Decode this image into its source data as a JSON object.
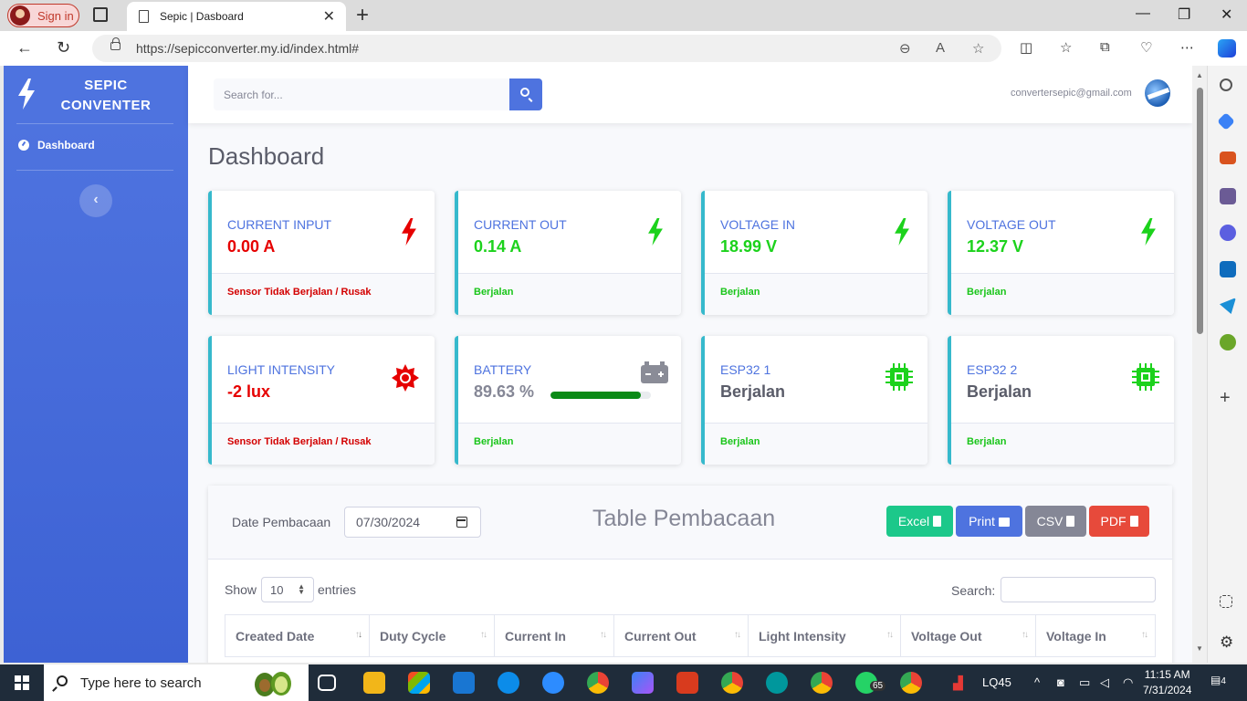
{
  "browser": {
    "signin_label": "Sign in",
    "tab_title": "Sepic | Dasboard",
    "url": "https://sepicconverter.my.id/index.html#"
  },
  "sidebar": {
    "brand_line1": "SEPIC",
    "brand_line2": "CONVENTER",
    "nav_dashboard": "Dashboard"
  },
  "topbar": {
    "search_placeholder": "Search for...",
    "user_email": "convertersepic@gmail.com"
  },
  "page": {
    "title": "Dashboard"
  },
  "cards": [
    {
      "label": "CURRENT INPUT",
      "value": "0.00 A",
      "status": "Sensor Tidak Berjalan / Rusak",
      "icon": "bolt-icon",
      "color": "#e60000"
    },
    {
      "label": "CURRENT OUT",
      "value": "0.14 A",
      "status": "Berjalan",
      "icon": "bolt-icon",
      "color": "#1cd21c"
    },
    {
      "label": "VOLTAGE IN",
      "value": "18.99 V",
      "status": "Berjalan",
      "icon": "bolt-icon",
      "color": "#1cd21c"
    },
    {
      "label": "VOLTAGE OUT",
      "value": "12.37 V",
      "status": "Berjalan",
      "icon": "bolt-icon",
      "color": "#1cd21c"
    },
    {
      "label": "LIGHT INTENSITY",
      "value": "-2 lux",
      "status": "Sensor Tidak Berjalan / Rusak",
      "icon": "sun-icon",
      "color": "#e60000"
    },
    {
      "label": "BATTERY",
      "value": "89.63 %",
      "status": "Berjalan",
      "icon": "battery-icon",
      "progress": 0.8963,
      "color": "#0a8a16"
    },
    {
      "label": "ESP32 1",
      "value": "Berjalan",
      "status": "Berjalan",
      "icon": "microchip-icon",
      "color": "#1cd21c"
    },
    {
      "label": "ESP32 2",
      "value": "Berjalan",
      "status": "Berjalan",
      "icon": "microchip-icon",
      "color": "#1cd21c"
    }
  ],
  "table_section": {
    "date_label": "Date Pembacaan",
    "date_value": "07/30/2024",
    "title": "Table Pembacaan",
    "buttons": {
      "excel": "Excel",
      "print": "Print",
      "csv": "CSV",
      "pdf": "PDF"
    },
    "show_label": "Show",
    "entries_value": "10",
    "entries_label": "entries",
    "search_label": "Search:",
    "columns": [
      "Created Date",
      "Duty Cycle",
      "Current In",
      "Current Out",
      "Light Intensity",
      "Voltage Out",
      "Voltage In"
    ]
  },
  "taskbar": {
    "search_text": "Type here to search",
    "whatsapp_badge": "65",
    "stock_label": "LQ45",
    "time": "11:15 AM",
    "date": "7/31/2024",
    "notifications": "4"
  }
}
